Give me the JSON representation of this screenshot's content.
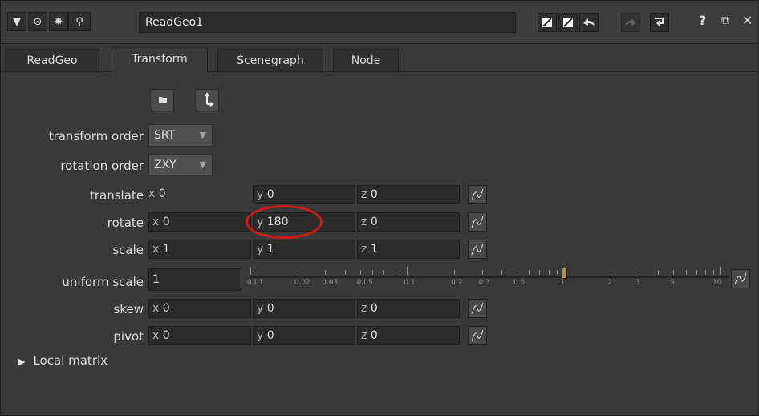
{
  "node_name": "ReadGeo1",
  "tabs": [
    "ReadGeo",
    "Transform",
    "Scenegraph",
    "Node"
  ],
  "active_tab": "Transform",
  "transform_order": {
    "label": "transform order",
    "value": "SRT"
  },
  "rotation_order": {
    "label": "rotation order",
    "value": "ZXY"
  },
  "rows": [
    {
      "label": "translate",
      "x": "0",
      "y": "0",
      "z": "0"
    },
    {
      "label": "rotate",
      "x": "0",
      "y": "180",
      "z": "0"
    },
    {
      "label": "scale",
      "x": "1",
      "y": "1",
      "z": "1"
    }
  ],
  "uniform_scale": {
    "label": "uniform scale",
    "value": "1",
    "slider_ticks": [
      "0.01",
      "0.02",
      "0.03",
      "0.05",
      "0.1",
      "0.2",
      "0.3",
      "0.5",
      "1",
      "2",
      "3",
      "5",
      "10"
    ]
  },
  "rows2": [
    {
      "label": "skew",
      "x": "0",
      "y": "0",
      "z": "0"
    },
    {
      "label": "pivot",
      "x": "0",
      "y": "0",
      "z": "0"
    }
  ],
  "axis_prefix": {
    "x": "x",
    "y": "y",
    "z": "z"
  },
  "local_matrix": "Local matrix",
  "highlight_color": "#d41818"
}
